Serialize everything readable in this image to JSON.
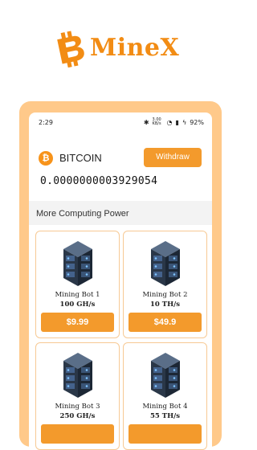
{
  "brand": {
    "name": "MineX",
    "accent": "#f28c14"
  },
  "status": {
    "time": "2:29",
    "battery": "92%",
    "speed": "3.00 KB/s"
  },
  "coin": {
    "symbol_icon": "bitcoin-icon",
    "name": "BITCOIN",
    "withdraw_label": "Withdraw",
    "balance": "0.0000000003929054"
  },
  "section": {
    "title": "More Computing Power"
  },
  "bots": [
    {
      "name": "Mining Bot 1",
      "rate": "100 GH/s",
      "price": "$9.99"
    },
    {
      "name": "Mining Bot 2",
      "rate": "10 TH/s",
      "price": "$49.9"
    },
    {
      "name": "Mining Bot 3",
      "rate": "250 GH/s",
      "price": ""
    },
    {
      "name": "Mining Bot 4",
      "rate": "55 TH/s",
      "price": ""
    }
  ],
  "colors": {
    "frame": "#ffc98a",
    "button": "#f39a2c",
    "card_border": "#f7c994"
  }
}
